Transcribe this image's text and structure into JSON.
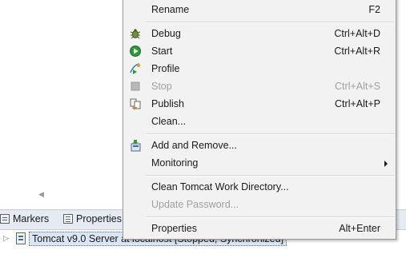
{
  "menu": {
    "items": [
      {
        "label": "Rename",
        "shortcut": "F2"
      },
      {
        "label": "Debug",
        "shortcut": "Ctrl+Alt+D",
        "icon": "debug-bug-icon"
      },
      {
        "label": "Start",
        "shortcut": "Ctrl+Alt+R",
        "icon": "start-run-icon"
      },
      {
        "label": "Profile",
        "shortcut": "",
        "icon": "profile-icon"
      },
      {
        "label": "Stop",
        "shortcut": "Ctrl+Alt+S",
        "icon": "stop-icon",
        "disabled": true
      },
      {
        "label": "Publish",
        "shortcut": "Ctrl+Alt+P",
        "icon": "publish-icon"
      },
      {
        "label": "Clean...",
        "shortcut": ""
      },
      {
        "label": "Add and Remove...",
        "shortcut": "",
        "icon": "add-remove-icon"
      },
      {
        "label": "Monitoring",
        "shortcut": "",
        "submenu": true
      },
      {
        "label": "Clean Tomcat Work Directory...",
        "shortcut": ""
      },
      {
        "label": "Update Password...",
        "shortcut": "",
        "disabled": true
      },
      {
        "label": "Properties",
        "shortcut": "Alt+Enter"
      }
    ]
  },
  "tabs": {
    "markers": "Markers",
    "properties": "Properties"
  },
  "server": {
    "label": "Tomcat v9.0 Server at localhost  [Stopped, Synchronized]"
  },
  "colors": {
    "menu_bg": "#f2f2f2",
    "tabbar_bg": "#e6ebf3",
    "selection_bg": "#dbe6f4",
    "disabled_text": "#a0a0a0"
  }
}
